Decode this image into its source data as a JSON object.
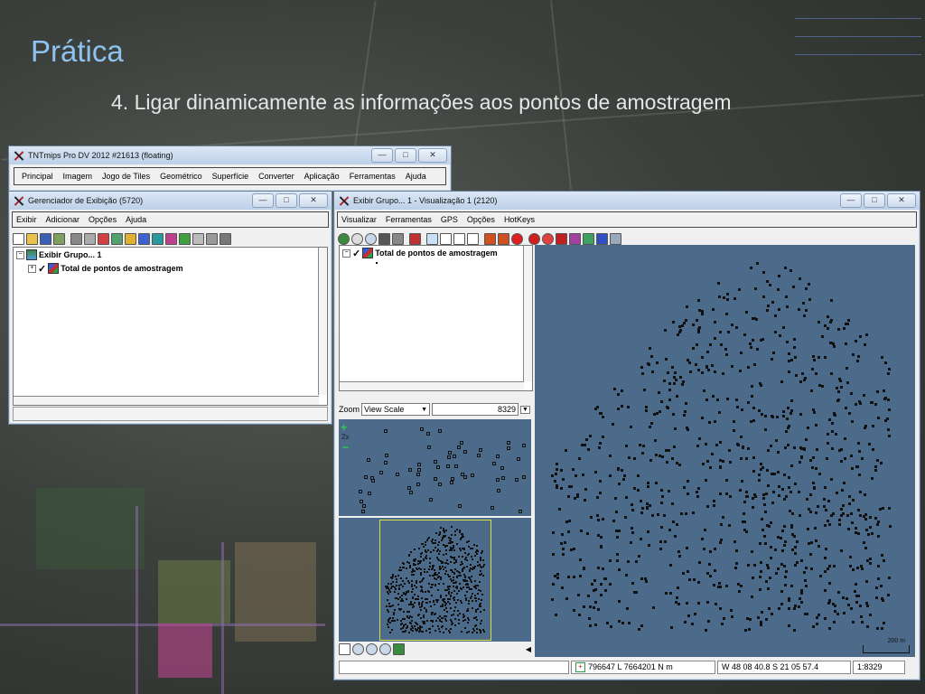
{
  "slide": {
    "title": "Prática",
    "subtitle": "4. Ligar dinamicamente as informações aos pontos de amostragem"
  },
  "main_window": {
    "title": "TNTmips Pro DV 2012  #21613 (floating)",
    "menu": [
      "Principal",
      "Imagem",
      "Jogo de Tiles",
      "Geométrico",
      "Superfície",
      "Converter",
      "Aplicação",
      "Ferramentas",
      "Ajuda"
    ]
  },
  "display_manager": {
    "title": "Gerenciador de Exibição (5720)",
    "menu": [
      "Exibir",
      "Adicionar",
      "Opções",
      "Ajuda"
    ],
    "tree": {
      "group_label": "Exibir Grupo... 1",
      "layer_label": "Total de pontos de amostragem"
    }
  },
  "view_window": {
    "title": "Exibir Grupo... 1 - Visualização 1 (2120)",
    "menu": [
      "Visualizar",
      "Ferramentas",
      "GPS",
      "Opções",
      "HotKeys"
    ],
    "legend_layer_label": "Total de pontos de amostragem",
    "zoom_label": "Zoom",
    "zoom_mode": "View Scale",
    "zoom_value": "8329",
    "zoom_level_label": "2x",
    "scale_bar_label": "200 m",
    "status": {
      "coords_map": "796647 L  7664201 N m",
      "coords_geo": "W 48 08 40.8  S 21 05 57.4",
      "scale": "1:8329"
    }
  },
  "colors": {
    "title_accent": "#8fc3ef",
    "map_background": "#4c6a8a",
    "locator_frame": "#d8e040"
  },
  "window_buttons": {
    "minimize": "—",
    "maximize": "□",
    "close": "✕"
  }
}
